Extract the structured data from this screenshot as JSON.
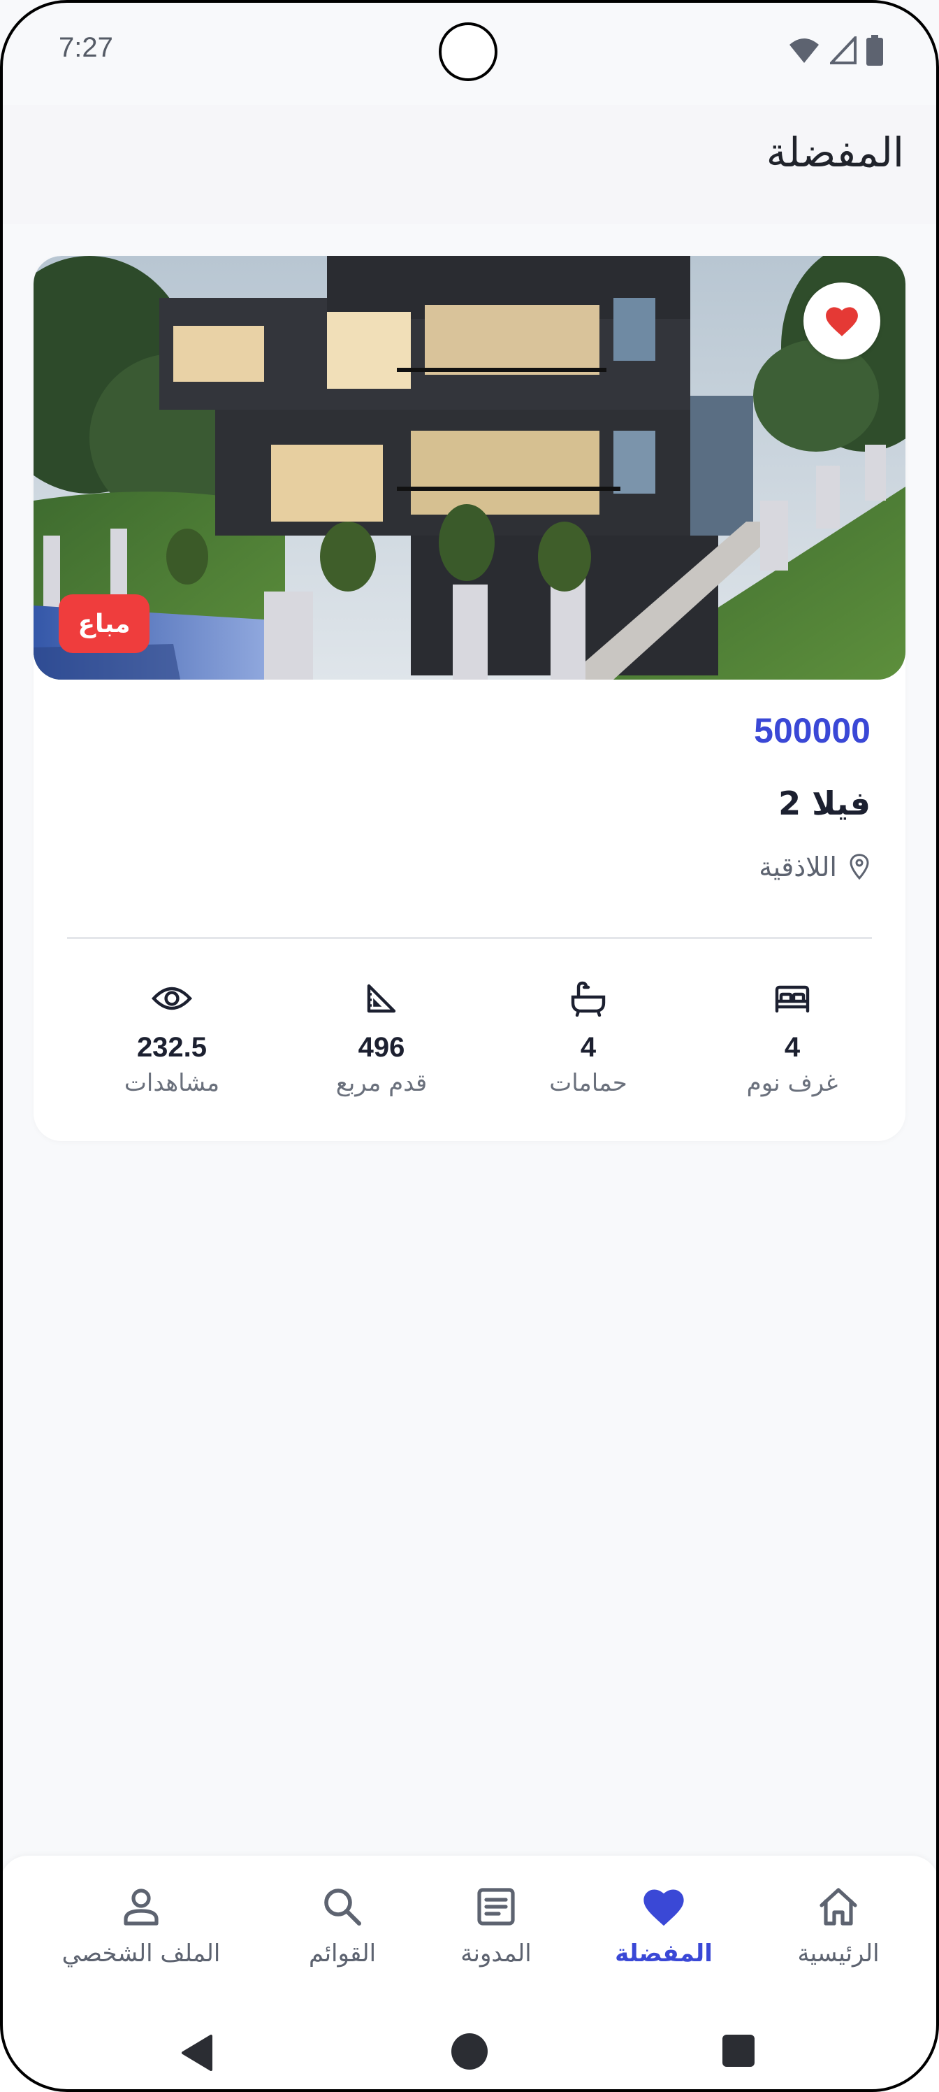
{
  "status_bar": {
    "time": "7:27",
    "icons": [
      "wifi-icon",
      "signal-icon",
      "battery-icon"
    ]
  },
  "header": {
    "title": "المفضلة"
  },
  "listing": {
    "image_alt": "modern-villa-photo",
    "is_favorite": true,
    "badge": "مباع",
    "price": "500000",
    "title": "فيلا 2",
    "location": "اللاذقية",
    "stats": {
      "bedrooms": {
        "value": "4",
        "label": "غرف نوم",
        "icon": "bed-icon"
      },
      "bathrooms": {
        "value": "4",
        "label": "حمامات",
        "icon": "bathtub-icon"
      },
      "area": {
        "value": "496",
        "label": "قدم مربع",
        "icon": "ruler-triangle-icon"
      },
      "views": {
        "value": "232.5",
        "label": "مشاهدات",
        "icon": "eye-icon"
      }
    }
  },
  "bottom_nav": {
    "items": [
      {
        "label": "الرئيسية",
        "icon": "home-icon",
        "active": false
      },
      {
        "label": "المفضلة",
        "icon": "heart-icon",
        "active": true
      },
      {
        "label": "المدونة",
        "icon": "article-icon",
        "active": false
      },
      {
        "label": "القوائم",
        "icon": "search-icon",
        "active": false
      },
      {
        "label": "الملف الشخصي",
        "icon": "person-icon",
        "active": false
      }
    ]
  },
  "colors": {
    "accent": "#3a48d6",
    "badge": "#ef3d3d",
    "heart": "#e53935",
    "background": "#f8f9fb"
  }
}
